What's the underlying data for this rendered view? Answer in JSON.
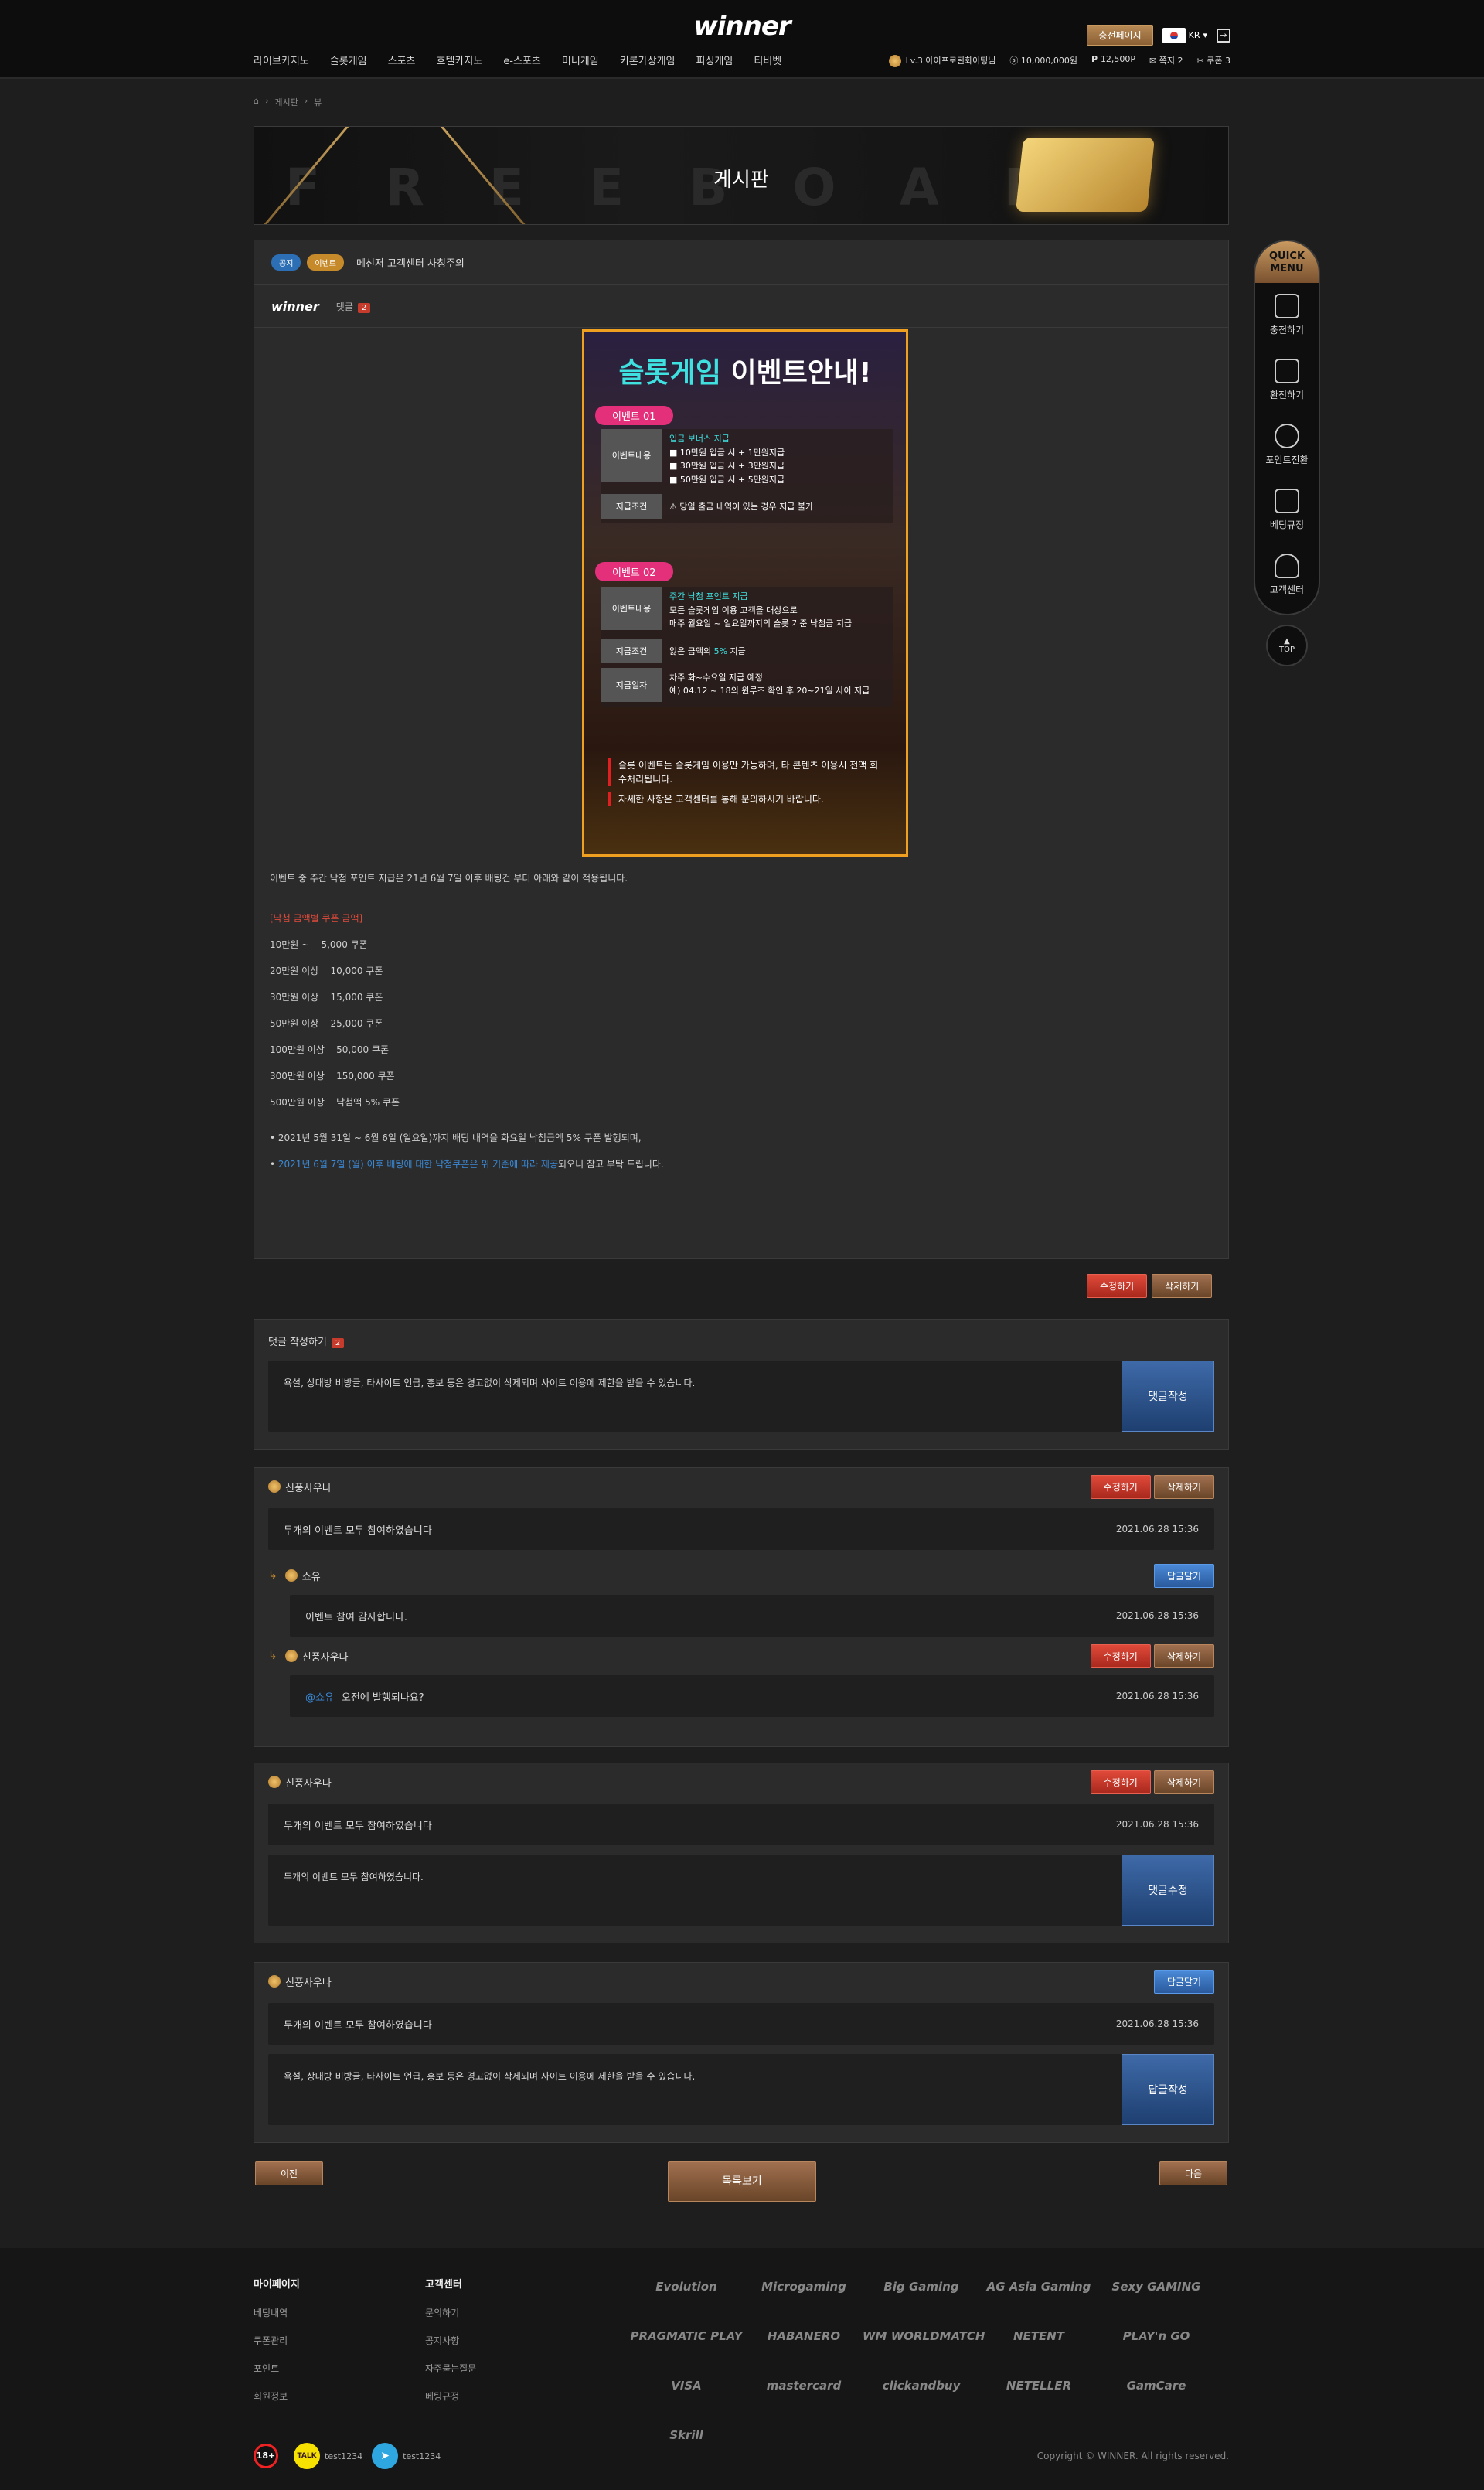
{
  "header": {
    "logo": "winner",
    "nav": [
      "라이브카지노",
      "슬롯게임",
      "스포츠",
      "호텔카지노",
      "e-스포츠",
      "미니게임",
      "키론가상게임",
      "피싱게임",
      "티비벳"
    ],
    "charge_page_label": "충전페이지",
    "lang": "KR",
    "user": {
      "level": "Lv.3 아이프로틴화이팅님",
      "balance": "10,000,000원",
      "points": "12,500P",
      "notes": "쪽지 2",
      "coupons": "쿠폰 3"
    }
  },
  "breadcrumb": [
    "⌂",
    "게시판",
    "뷰"
  ],
  "banner": {
    "title": "게시판",
    "bg_text": "FREEBOARD"
  },
  "post": {
    "badge_notice": "공지",
    "badge_event": "이벤트",
    "title": "메신저 고객센터 사칭주의",
    "author_logo": "winner",
    "comment_label": "댓글",
    "comment_count": "2"
  },
  "poster": {
    "title_cyan": "슬롯게임",
    "title_white": " 이벤트안내!",
    "event1_pill": "이벤트 01",
    "event1": {
      "label1": "이벤트내용",
      "heading": "입금 보너스 지급",
      "lines": [
        "■ 10만원 입금 시 + 1만원지급",
        "■ 30만원 입금 시 + 3만원지급",
        "■ 50만원 입금 시 + 5만원지급"
      ],
      "label2": "지급조건",
      "condition": "⚠ 당일 출금 내역이 있는 경우 지급 불가"
    },
    "event2_pill": "이벤트 02",
    "event2": {
      "label1": "이벤트내용",
      "heading": "주간 낙첨 포인트 지급",
      "lines": [
        "모든 슬롯게임 이용 고객을 대상으로",
        "매주 월요일 ~ 일요일까지의 슬롯 기준 낙첨금 지급"
      ],
      "label2": "지급조건",
      "condition_pre": "잃은 금액의 ",
      "condition_hl": "5%",
      "condition_post": " 지급",
      "label3": "지급일자",
      "dates": [
        "차주 화~수요일 지급 예정",
        "예) 04.12 ~ 18의 윈루즈 확인 후 20~21일 사이 지급"
      ]
    },
    "notes": [
      "슬롯 이벤트는 슬롯게임 이용만 가능하며, 타 콘텐츠 이용시 전액 회수처리됩니다.",
      "자세한 사항은 고객센터를 통해 문의하시기 바랍니다."
    ]
  },
  "content": {
    "intro": "이벤트 중 주간 낙첨 포인트 지급은 21년 6월 7일 이후 배팅건 부터 아래와 같이 적용됩니다.",
    "section_title": "[낙첨 금액별 쿠폰 금액]",
    "coupons": [
      "10만원 ~    5,000 쿠폰",
      "20만원 이상    10,000 쿠폰",
      "30만원 이상    15,000 쿠폰",
      "50만원 이상    25,000 쿠폰",
      "100만원 이상    50,000 쿠폰",
      "300만원 이상    150,000 쿠폰",
      "500만원 이상    낙첨액 5% 쿠폰"
    ],
    "note1": "• 2021년 5월 31일 ~ 6월 6일 (일요일)까지 배팅 내역을 화요일 낙첨금액 5% 쿠폰 발행되며,",
    "note2_pre": "• ",
    "note2_blue": "2021년 6월 7일 (월) 이후 배팅에 대한 낙첨쿠폰은 위 기준에 따라 제공",
    "note2_post": "되오니 참고 부탁 드립니다."
  },
  "actions": {
    "edit": "수정하기",
    "delete": "삭제하기"
  },
  "comment_form": {
    "title": "댓글 작성하기",
    "count": "2",
    "placeholder": "욕설, 상대방 비방글, 타사이트 언급, 홍보 등은 경고없이 삭제되며 사이트 이용에 제한을 받을 수 있습니다.",
    "submit": "댓글작성"
  },
  "thread1": {
    "author": "신풍사우나",
    "edit": "수정하기",
    "delete": "삭제하기",
    "text": "두개의 이벤트 모두 참여하였습니다",
    "date": "2021.06.28 15:36",
    "reply1": {
      "author": "쇼유",
      "reply_btn": "답글달기",
      "text": "이벤트 참여 감사합니다.",
      "date": "2021.06.28 15:36"
    },
    "reply2": {
      "author": "신풍사우나",
      "edit": "수정하기",
      "delete": "삭제하기",
      "mention": "@쇼유",
      "text": "오전에 발행되나요?",
      "date": "2021.06.28 15:36"
    }
  },
  "thread2": {
    "author": "신풍사우나",
    "edit": "수정하기",
    "delete": "삭제하기",
    "text": "두개의 이벤트 모두 참여하였습니다",
    "date": "2021.06.28 15:36",
    "edit_text": "두개의 이벤트 모두 참여하였습니다.",
    "edit_submit": "댓글수정"
  },
  "thread3": {
    "author": "신풍사우나",
    "reply_btn": "답글달기",
    "text": "두개의 이벤트 모두 참여하였습니다",
    "date": "2021.06.28 15:36",
    "reply_placeholder": "욕설, 상대방 비방글, 타사이트 언급, 홍보 등은 경고없이 삭제되며 사이트 이용에 제한을 받을 수 있습니다.",
    "reply_submit": "답글작성"
  },
  "pager": {
    "prev": "이전",
    "list": "목록보기",
    "next": "다음"
  },
  "quick_menu": {
    "title": "QUICK MENU",
    "items": [
      "충전하기",
      "환전하기",
      "포인트전환",
      "베팅규정",
      "고객센터"
    ],
    "top": "TOP"
  },
  "footer": {
    "col1": {
      "title": "마이페이지",
      "links": [
        "베팅내역",
        "쿠폰관리",
        "포인트",
        "회원정보"
      ]
    },
    "col2": {
      "title": "고객센터",
      "links": [
        "문의하기",
        "공지사항",
        "자주묻는질문",
        "베팅규정"
      ]
    },
    "providers": [
      "Evolution",
      "Microgaming",
      "Big Gaming",
      "AG Asia Gaming",
      "Sexy GAMING",
      "PRAGMATIC PLAY",
      "HABANERO",
      "WM WORLDMATCH",
      "NETENT",
      "PLAY'n GO",
      "VISA",
      "mastercard",
      "clickandbuy",
      "NETELLER",
      "GamCare",
      "Skrill"
    ],
    "age": "18+",
    "kakao_id": "test1234",
    "telegram_id": "test1234",
    "copyright": "Copyright © WINNER. All rights reserved."
  }
}
